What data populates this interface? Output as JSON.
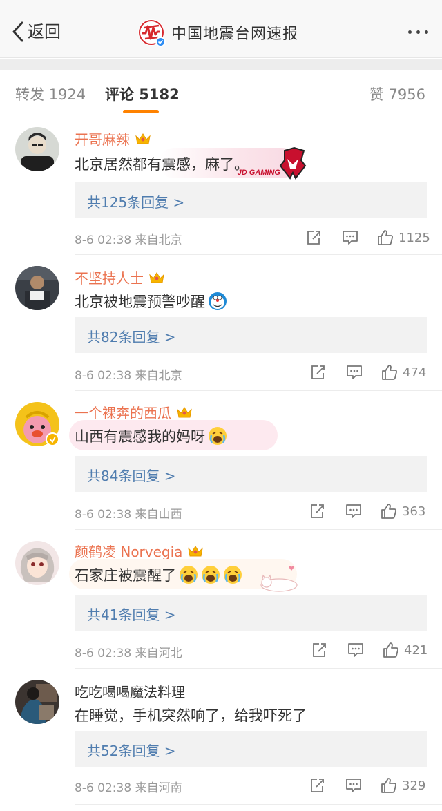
{
  "header": {
    "back_label": "返回",
    "title": "中国地震台网速报"
  },
  "tabs": [
    {
      "label": "转发 1924"
    },
    {
      "label": "评论 5182",
      "active": true
    },
    {
      "label": "赞 7956"
    }
  ],
  "colors": {
    "accent": "#ff8200",
    "username": "#eb7350",
    "link": "#507daf"
  },
  "comments": [
    {
      "username": "开哥麻辣",
      "text": "北京居然都有震感，麻了。",
      "replies": "共125条回复 >",
      "meta": "8-6 02:38  来自北京",
      "likes": "1125",
      "badge_text": "JD GAMING"
    },
    {
      "username": "不坚持人士",
      "text": "北京被地震预警吵醒",
      "replies": "共82条回复 >",
      "meta": "8-6 02:38  来自北京",
      "likes": "474"
    },
    {
      "username": "一个裸奔的西瓜",
      "text": "山西有震感我的妈呀",
      "replies": "共84条回复 >",
      "meta": "8-6 02:38  来自山西",
      "likes": "363"
    },
    {
      "username": "颜鹤凌 Norvegia",
      "text": "石家庄被震醒了",
      "replies": "共41条回复 >",
      "meta": "8-6 02:38  来自河北",
      "likes": "421"
    },
    {
      "username": "吃吃喝喝魔法料理",
      "text": "在睡觉，手机突然响了，给我吓死了",
      "replies": "共52条回复 >",
      "meta": "8-6 02:38  来自河南",
      "likes": "329"
    }
  ]
}
